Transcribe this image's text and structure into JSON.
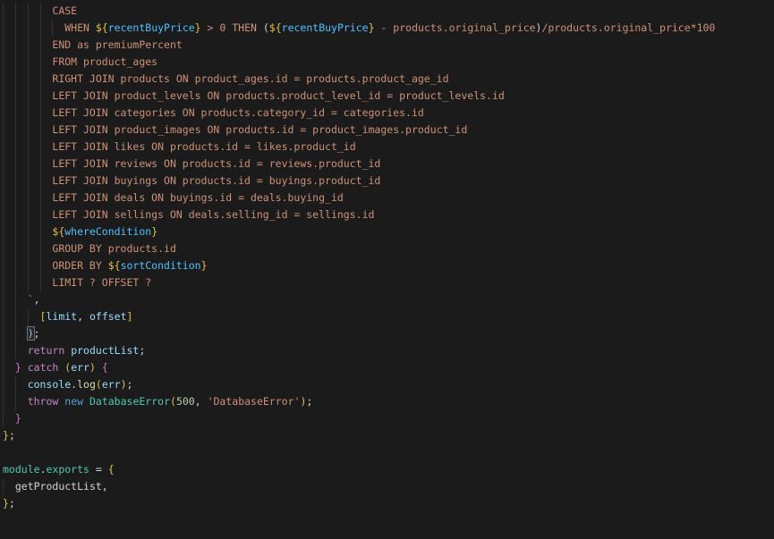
{
  "editor": {
    "kind": "code-editor-viewport",
    "background": "#1b1b1b",
    "guide_color": "#333333",
    "bracket_match_border": "#6e6e6e",
    "palette": {
      "string": "#ce9178",
      "var": "#4fc1ff",
      "ident": "#9cdcfe",
      "keyword": "#c586c0",
      "kwblue": "#569cd6",
      "class": "#4ec9b0",
      "number": "#b5cea8",
      "method": "#dcdcaa",
      "fg": "#d4d4d4",
      "gold": "#e2c04c",
      "pink": "#d670d6",
      "bracketblue": "#8fc8f2"
    },
    "lines": [
      {
        "indent": 8,
        "tokens": [
          {
            "t": "CASE",
            "c": "string"
          }
        ]
      },
      {
        "indent": 10,
        "tokens": [
          {
            "t": "WHEN ",
            "c": "string"
          },
          {
            "t": "${",
            "c": "gold"
          },
          {
            "t": "recentBuyPrice",
            "c": "var"
          },
          {
            "t": "}",
            "c": "gold"
          },
          {
            "t": " > 0 THEN ",
            "c": "string"
          },
          {
            "t": "(",
            "c": "fg"
          },
          {
            "t": "${",
            "c": "gold"
          },
          {
            "t": "recentBuyPrice",
            "c": "var"
          },
          {
            "t": "}",
            "c": "gold"
          },
          {
            "t": " - products.original_price",
            "c": "string"
          },
          {
            "t": ")",
            "c": "fg"
          },
          {
            "t": "/products.original_price*100",
            "c": "string"
          }
        ]
      },
      {
        "indent": 8,
        "tokens": [
          {
            "t": "END as premiumPercent",
            "c": "string"
          }
        ]
      },
      {
        "indent": 8,
        "tokens": [
          {
            "t": "FROM product_ages",
            "c": "string"
          }
        ]
      },
      {
        "indent": 8,
        "tokens": [
          {
            "t": "RIGHT JOIN products ON product_ages.id = products.product_age_id",
            "c": "string"
          }
        ]
      },
      {
        "indent": 8,
        "tokens": [
          {
            "t": "LEFT JOIN product_levels ON products.product_level_id = product_levels.id",
            "c": "string"
          }
        ]
      },
      {
        "indent": 8,
        "tokens": [
          {
            "t": "LEFT JOIN categories ON products.category_id = categories.id",
            "c": "string"
          }
        ]
      },
      {
        "indent": 8,
        "tokens": [
          {
            "t": "LEFT JOIN product_images ON products.id = product_images.product_id",
            "c": "string"
          }
        ]
      },
      {
        "indent": 8,
        "tokens": [
          {
            "t": "LEFT JOIN likes ON products.id = likes.product_id",
            "c": "string"
          }
        ]
      },
      {
        "indent": 8,
        "tokens": [
          {
            "t": "LEFT JOIN reviews ON products.id = reviews.product_id",
            "c": "string"
          }
        ]
      },
      {
        "indent": 8,
        "tokens": [
          {
            "t": "LEFT JOIN buyings ON products.id = buyings.product_id",
            "c": "string"
          }
        ]
      },
      {
        "indent": 8,
        "tokens": [
          {
            "t": "LEFT JOIN deals ON buyings.id = deals.buying_id",
            "c": "string"
          }
        ]
      },
      {
        "indent": 8,
        "tokens": [
          {
            "t": "LEFT JOIN sellings ON deals.selling_id = sellings.id",
            "c": "string"
          }
        ]
      },
      {
        "indent": 8,
        "tokens": [
          {
            "t": "${",
            "c": "gold"
          },
          {
            "t": "whereCondition",
            "c": "var"
          },
          {
            "t": "}",
            "c": "gold"
          }
        ]
      },
      {
        "indent": 8,
        "tokens": [
          {
            "t": "GROUP BY products.id",
            "c": "string"
          }
        ]
      },
      {
        "indent": 8,
        "tokens": [
          {
            "t": "ORDER BY ",
            "c": "string"
          },
          {
            "t": "${",
            "c": "gold"
          },
          {
            "t": "sortCondition",
            "c": "var"
          },
          {
            "t": "}",
            "c": "gold"
          }
        ]
      },
      {
        "indent": 8,
        "tokens": [
          {
            "t": "LIMIT ? OFFSET ?",
            "c": "string"
          }
        ]
      },
      {
        "indent": 4,
        "tokens": [
          {
            "t": "`",
            "c": "string"
          },
          {
            "t": ",",
            "c": "fg"
          }
        ]
      },
      {
        "indent": 6,
        "tokens": [
          {
            "t": "[",
            "c": "gold"
          },
          {
            "t": "limit",
            "c": "ident"
          },
          {
            "t": ", ",
            "c": "fg"
          },
          {
            "t": "offset",
            "c": "ident"
          },
          {
            "t": "]",
            "c": "gold"
          }
        ]
      },
      {
        "indent": 4,
        "tokens": [
          {
            "t": ")",
            "c": "bracketblue",
            "box": true
          },
          {
            "t": ";",
            "c": "fg"
          }
        ]
      },
      {
        "indent": 4,
        "tokens": [
          {
            "t": "return",
            "c": "keyword"
          },
          {
            "t": " ",
            "c": "fg"
          },
          {
            "t": "productList",
            "c": "ident"
          },
          {
            "t": ";",
            "c": "fg"
          }
        ]
      },
      {
        "indent": 2,
        "tokens": [
          {
            "t": "}",
            "c": "pink"
          },
          {
            "t": " ",
            "c": "fg"
          },
          {
            "t": "catch",
            "c": "keyword"
          },
          {
            "t": " ",
            "c": "fg"
          },
          {
            "t": "(",
            "c": "gold"
          },
          {
            "t": "err",
            "c": "ident"
          },
          {
            "t": ")",
            "c": "gold"
          },
          {
            "t": " ",
            "c": "fg"
          },
          {
            "t": "{",
            "c": "pink"
          }
        ]
      },
      {
        "indent": 4,
        "tokens": [
          {
            "t": "console",
            "c": "ident"
          },
          {
            "t": ".",
            "c": "fg"
          },
          {
            "t": "log",
            "c": "method"
          },
          {
            "t": "(",
            "c": "gold"
          },
          {
            "t": "err",
            "c": "ident"
          },
          {
            "t": ")",
            "c": "gold"
          },
          {
            "t": ";",
            "c": "fg"
          }
        ]
      },
      {
        "indent": 4,
        "tokens": [
          {
            "t": "throw",
            "c": "keyword"
          },
          {
            "t": " ",
            "c": "fg"
          },
          {
            "t": "new",
            "c": "kwblue"
          },
          {
            "t": " ",
            "c": "fg"
          },
          {
            "t": "DatabaseError",
            "c": "class"
          },
          {
            "t": "(",
            "c": "gold"
          },
          {
            "t": "500",
            "c": "number"
          },
          {
            "t": ", ",
            "c": "fg"
          },
          {
            "t": "'DatabaseError'",
            "c": "string"
          },
          {
            "t": ")",
            "c": "gold"
          },
          {
            "t": ";",
            "c": "fg"
          }
        ]
      },
      {
        "indent": 2,
        "tokens": [
          {
            "t": "}",
            "c": "pink"
          }
        ]
      },
      {
        "indent": 0,
        "tokens": [
          {
            "t": "}",
            "c": "gold"
          },
          {
            "t": ";",
            "c": "fg"
          }
        ]
      },
      {
        "indent": 0,
        "tokens": []
      },
      {
        "indent": 0,
        "tokens": [
          {
            "t": "module",
            "c": "class"
          },
          {
            "t": ".",
            "c": "fg"
          },
          {
            "t": "exports",
            "c": "class"
          },
          {
            "t": " = ",
            "c": "fg"
          },
          {
            "t": "{",
            "c": "gold"
          }
        ]
      },
      {
        "indent": 2,
        "tokens": [
          {
            "t": "getProductList",
            "c": "fg"
          },
          {
            "t": ",",
            "c": "fg"
          }
        ]
      },
      {
        "indent": 0,
        "tokens": [
          {
            "t": "}",
            "c": "gold"
          },
          {
            "t": ";",
            "c": "fg"
          }
        ]
      }
    ]
  }
}
